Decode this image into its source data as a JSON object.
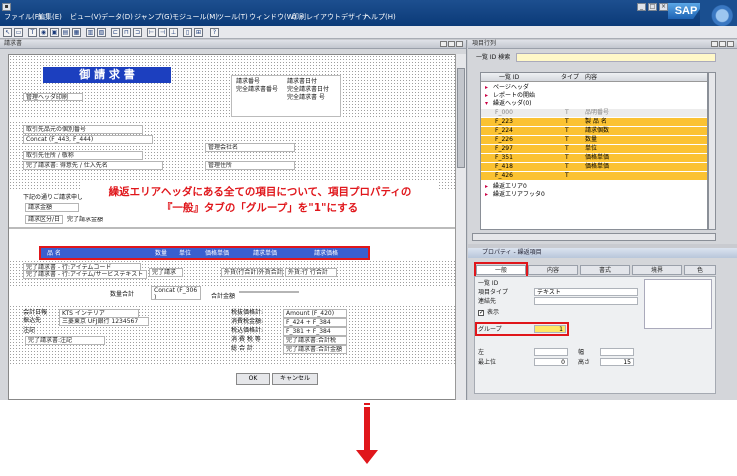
{
  "menu": [
    "ファイル(F)",
    "編集(E)",
    "ビュー(V)",
    "データ(D)",
    "ジャンプ(G)",
    "モジュール(M)",
    "ツール(T)",
    "ウィンドウ(W)",
    "印刷レイアウトデザイナ",
    "ヘルプ(H)"
  ],
  "logo": "SAP",
  "designer": {
    "title": "請求書",
    "doc_title": "御 請 求 書",
    "header_label": "管理ヘッダ印刷",
    "box_fields": [
      "請求番号",
      "請求書日付",
      "完全請求書番号",
      "完全請求書日付",
      "完全請求書 号"
    ],
    "customer_fields": [
      "取引先品元の個別番号",
      "Concat (F_443, F_444)",
      "取引先住所 / 敬称",
      "完了請求書: 得意先 / 仕入先名"
    ],
    "mgmt_fields": [
      "管理会社名",
      "管理住所"
    ],
    "lower_labels": [
      "下記の通りご請求申し",
      "請求金額",
      "請求区分/日",
      "完了請求金額"
    ],
    "band_cells": [
      "品 名",
      "数量",
      "単位",
      "価格単価",
      "請求単価",
      "請求価格"
    ],
    "row_fields": [
      "完了請求書 - 行:アイテムコード",
      "完了請求書 - 行:アイテム/サービステキスト",
      "完了請求",
      "外貨(行合計)外貨合計",
      "外貨:行 行合計"
    ],
    "subtotal": "数量合計",
    "concat": "Concat (F_306 )",
    "total_label": "合計金額",
    "footer_left": [
      "会計日報",
      "KTS インテリア",
      "三菱東京 UFJ銀行 1234567",
      "振込先",
      "注記",
      "完了請求書:注記"
    ],
    "footer_right": [
      "税抜価格計:",
      "Amount (F_420)",
      "消費税金額:",
      "F_424 + F_384",
      "税込価格計:",
      "F_381 + F_384",
      "消 費 税 等",
      "完了請求書:合計税",
      "総 合 計",
      "完了請求書:合計金額"
    ],
    "buttons": [
      "OK",
      "キャンセル"
    ]
  },
  "callout": {
    "line1": "繰返エリアヘッダにある全ての項目について、項目プロパティの",
    "line2": "『一般』タブの「グループ」を\"1\"にする"
  },
  "rows_pane": {
    "title": "項目行列",
    "search_label": "一覧 ID 検索",
    "columns": [
      "一覧 ID",
      "タイプ",
      "内容"
    ],
    "tree": [
      "ページヘッダ",
      "レポートの開始",
      "繰返ヘッダ(0)"
    ],
    "rows": [
      {
        "id": "F_000",
        "type": "T",
        "content": "品明番号"
      },
      {
        "id": "F_223",
        "type": "T",
        "content": "製 品 名"
      },
      {
        "id": "F_224",
        "type": "T",
        "content": "請求個数"
      },
      {
        "id": "F_226",
        "type": "T",
        "content": "数量"
      },
      {
        "id": "F_297",
        "type": "T",
        "content": "単位"
      },
      {
        "id": "F_351",
        "type": "T",
        "content": "価格単価"
      },
      {
        "id": "F_418",
        "type": "T",
        "content": "価格単価"
      },
      {
        "id": "F_426",
        "type": "T",
        "content": ""
      }
    ],
    "tree_after": [
      "繰返エリア0",
      "繰返エリアフッタ0"
    ]
  },
  "props_pane": {
    "title": "プロパティ - 繰返項目",
    "tabs": [
      "一般",
      "内容",
      "書式",
      "境界",
      "色"
    ],
    "fields": [
      {
        "label": "一覧 ID",
        "value": ""
      },
      {
        "label": "項目タイプ",
        "value": "テキスト"
      },
      {
        "label": "連結先",
        "value": ""
      }
    ],
    "display_label": "表示",
    "group_label": "グループ",
    "group_value": "1",
    "pos_labels": [
      "左",
      "幅",
      "最上位",
      "高さ"
    ],
    "pos_values": [
      "",
      "",
      "0",
      "15"
    ]
  }
}
